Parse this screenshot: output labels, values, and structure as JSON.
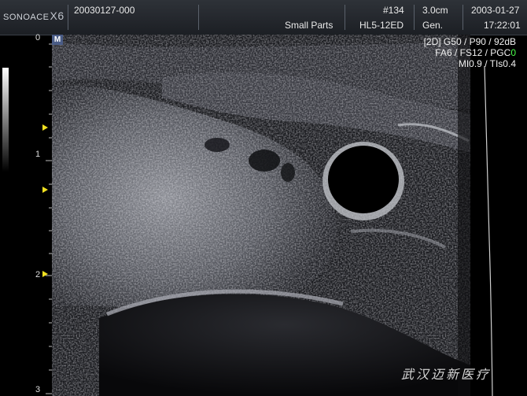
{
  "header": {
    "logo_brand": "SONOACE",
    "logo_model": "X6",
    "patient_id": "20030127-000",
    "preset": "Small Parts",
    "image_number": "#134",
    "probe": "HL5-12ED",
    "depth": "3.0cm",
    "frequency": "Gen.",
    "date": "2003-01-27",
    "time": "17:22:01"
  },
  "marker": "M",
  "params": {
    "line1": "[2D] G50 / P90 / 92dB",
    "line2_prefix": "FA6 / FS12 / PGC",
    "line2_value": "0",
    "line3": "MI0.9 / TIs0.4"
  },
  "depth_scale": {
    "labels": [
      "0",
      "1",
      "2",
      "3"
    ]
  },
  "watermark": "武汉迈新医疗"
}
